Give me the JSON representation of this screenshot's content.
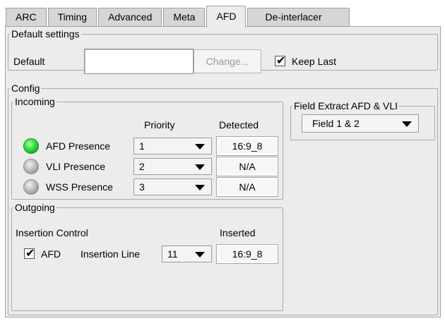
{
  "tabs": [
    {
      "label": "ARC"
    },
    {
      "label": "Timing"
    },
    {
      "label": "Advanced"
    },
    {
      "label": "Meta"
    },
    {
      "label": "AFD",
      "active": true
    },
    {
      "label": "De-interlacer"
    }
  ],
  "default_settings": {
    "legend": "Default settings",
    "default_label": "Default",
    "default_value": "",
    "change_button": "Change...",
    "keep_last_label": "Keep Last",
    "keep_last_checked": true
  },
  "config": {
    "legend": "Config",
    "incoming": {
      "legend": "Incoming",
      "priority_header": "Priority",
      "detected_header": "Detected",
      "rows": [
        {
          "label": "AFD Presence",
          "active": true,
          "priority": "1",
          "detected": "16:9_8"
        },
        {
          "label": "VLI Presence",
          "active": false,
          "priority": "2",
          "detected": "N/A"
        },
        {
          "label": "WSS Presence",
          "active": false,
          "priority": "3",
          "detected": "N/A"
        }
      ]
    },
    "outgoing": {
      "legend": "Outgoing",
      "insertion_control_label": "Insertion Control",
      "inserted_header": "Inserted",
      "afd_label": "AFD",
      "afd_checked": true,
      "insertion_line_label": "Insertion Line",
      "insertion_line_value": "11",
      "inserted_value": "16:9_8"
    },
    "field_extract": {
      "legend": "Field Extract AFD & VLI",
      "value": "Field 1 & 2"
    }
  },
  "colors": {
    "led_active": "#22c72e",
    "led_inactive": "#a8a8a8",
    "panel_bg": "#ececec"
  }
}
